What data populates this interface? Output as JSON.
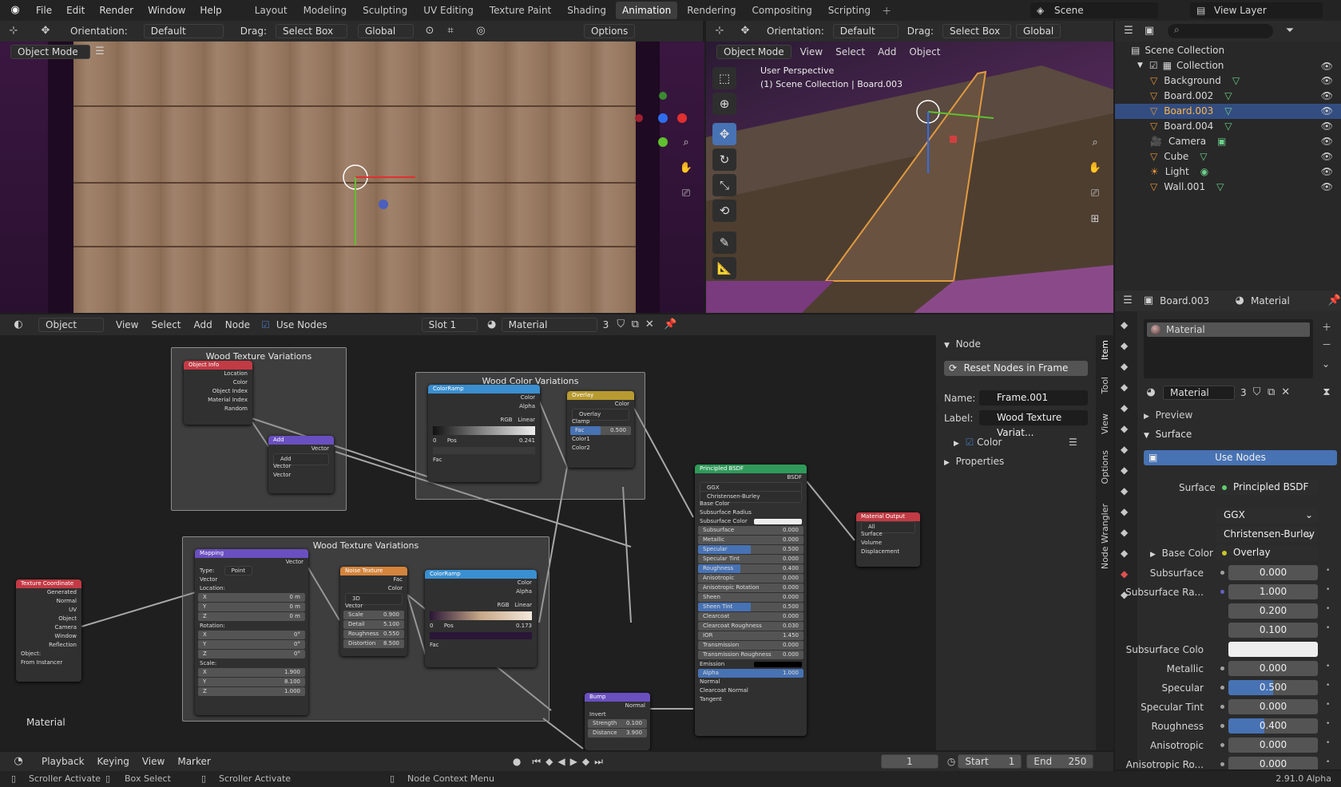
{
  "topbar": {
    "menus": [
      "File",
      "Edit",
      "Render",
      "Window",
      "Help"
    ],
    "workspaces": [
      "Layout",
      "Modeling",
      "Sculpting",
      "UV Editing",
      "Texture Paint",
      "Shading",
      "Animation",
      "Rendering",
      "Compositing",
      "Scripting"
    ],
    "active_workspace": "Animation",
    "scene": "Scene",
    "view_layer": "View Layer"
  },
  "vp_left": {
    "orientation_label": "Orientation:",
    "orientation": "Default",
    "drag_label": "Drag:",
    "drag": "Select Box",
    "transform": "Global",
    "options": "Options",
    "mode": "Object Mode"
  },
  "vp_right": {
    "orientation_label": "Orientation:",
    "orientation": "Default",
    "drag_label": "Drag:",
    "drag": "Select Box",
    "transform": "Global",
    "mode": "Object Mode",
    "menus": [
      "View",
      "Select",
      "Add",
      "Object"
    ],
    "overlay_line1": "User Perspective",
    "overlay_line2": "(1) Scene Collection | Board.003"
  },
  "outliner": {
    "root": "Scene Collection",
    "collection": "Collection",
    "items": [
      {
        "name": "Background",
        "icon": "mesh-icon"
      },
      {
        "name": "Board.002",
        "icon": "mesh-icon"
      },
      {
        "name": "Board.003",
        "icon": "mesh-icon",
        "selected": true
      },
      {
        "name": "Board.004",
        "icon": "mesh-icon"
      },
      {
        "name": "Camera",
        "icon": "camera-icon"
      },
      {
        "name": "Cube",
        "icon": "mesh-icon"
      },
      {
        "name": "Light",
        "icon": "light-icon"
      },
      {
        "name": "Wall.001",
        "icon": "mesh-icon"
      }
    ]
  },
  "node_editor": {
    "object_type": "Object",
    "menus": [
      "View",
      "Select",
      "Add",
      "Node"
    ],
    "use_nodes": "Use Nodes",
    "slot": "Slot 1",
    "material": "Material",
    "users": "3",
    "material_label": "Material",
    "frames": [
      "Wood Texture Variations",
      "Wood Color Variations",
      "Wood Texture Variations"
    ],
    "nodes": {
      "object_info": {
        "title": "Object Info",
        "outputs": [
          "Location",
          "Color",
          "Object Index",
          "Material Index",
          "Random"
        ]
      },
      "add": {
        "title": "Add",
        "out": "Vector",
        "op": "Add",
        "inputs": [
          "Vector",
          "Vector"
        ]
      },
      "colorramp1": {
        "title": "ColorRamp",
        "outputs": [
          "Color",
          "Alpha"
        ],
        "mode": "RGB",
        "interp": "Linear",
        "idx": "0",
        "pos_label": "Pos",
        "pos": "0.241",
        "fac": "Fac"
      },
      "overlay": {
        "title": "Overlay",
        "out": "Color",
        "blend": "Overlay",
        "clamp": "Clamp",
        "fac_label": "Fac",
        "fac": "0.500",
        "inputs": [
          "Color1",
          "Color2"
        ]
      },
      "texcoord": {
        "title": "Texture Coordinate",
        "outputs": [
          "Generated",
          "Normal",
          "UV",
          "Object",
          "Camera",
          "Window",
          "Reflection"
        ],
        "object_label": "Object:",
        "from_instancer": "From Instancer"
      },
      "mapping": {
        "title": "Mapping",
        "out": "Vector",
        "type_label": "Type:",
        "type": "Point",
        "vector": "Vector",
        "location": "Location:",
        "rotation": "Rotation:",
        "scale": "Scale:",
        "loc": [
          [
            "X",
            "0 m"
          ],
          [
            "Y",
            "0 m"
          ],
          [
            "Z",
            "0 m"
          ]
        ],
        "rot": [
          [
            "X",
            "0°"
          ],
          [
            "Y",
            "0°"
          ],
          [
            "Z",
            "0°"
          ]
        ],
        "scl": [
          [
            "X",
            "1.900"
          ],
          [
            "Y",
            "8.100"
          ],
          [
            "Z",
            "1.000"
          ]
        ]
      },
      "noise": {
        "title": "Noise Texture",
        "outputs": [
          "Fac",
          "Color"
        ],
        "dim": "3D",
        "vector": "Vector",
        "params": [
          [
            "Scale",
            "0.900"
          ],
          [
            "Detail",
            "5.100"
          ],
          [
            "Roughness",
            "0.550"
          ],
          [
            "Distortion",
            "8.500"
          ]
        ]
      },
      "colorramp2": {
        "title": "ColorRamp",
        "outputs": [
          "Color",
          "Alpha"
        ],
        "mode": "RGB",
        "interp": "Linear",
        "idx": "0",
        "pos_label": "Pos",
        "pos": "0.173",
        "fac": "Fac"
      },
      "bump": {
        "title": "Bump",
        "out": "Normal",
        "invert": "Invert",
        "params": [
          [
            "Strength",
            "0.100"
          ],
          [
            "Distance",
            "3.900"
          ]
        ]
      },
      "bsdf": {
        "title": "Principled BSDF",
        "out": "BSDF",
        "dist": "GGX",
        "sss": "Christensen-Burley",
        "base_color": "Base Color",
        "sss_radius": "Subsurface Radius",
        "sss_color": "Subsurface Color",
        "params": [
          [
            "Subsurface",
            "0.000"
          ],
          [
            "Metallic",
            "0.000"
          ],
          [
            "Specular",
            "0.500"
          ],
          [
            "Specular Tint",
            "0.000"
          ],
          [
            "Roughness",
            "0.400"
          ],
          [
            "Anisotropic",
            "0.000"
          ],
          [
            "Anisotropic Rotation",
            "0.000"
          ],
          [
            "Sheen",
            "0.000"
          ],
          [
            "Sheen Tint",
            "0.500"
          ],
          [
            "Clearcoat",
            "0.000"
          ],
          [
            "Clearcoat Roughness",
            "0.030"
          ],
          [
            "IOR",
            "1.450"
          ],
          [
            "Transmission",
            "0.000"
          ],
          [
            "Transmission Roughness",
            "0.000"
          ]
        ],
        "emission": "Emission",
        "alpha_label": "Alpha",
        "alpha": "1.000",
        "inputs": [
          "Normal",
          "Clearcoat Normal",
          "Tangent"
        ]
      },
      "output": {
        "title": "Material Output",
        "target": "All",
        "inputs": [
          "Surface",
          "Volume",
          "Displacement"
        ]
      }
    }
  },
  "n_panel": {
    "node": "Node",
    "reset": "Reset Nodes in Frame",
    "name_label": "Name:",
    "name": "Frame.001",
    "label_label": "Label:",
    "label": "Wood Texture Variat...",
    "color": "Color",
    "properties": "Properties",
    "tabs": [
      "Item",
      "Tool",
      "View",
      "Options",
      "Node Wrangler"
    ]
  },
  "properties": {
    "object": "Board.003",
    "material_tab": "Material",
    "slot": "Material",
    "mat_name": "Material",
    "users": "3",
    "preview": "Preview",
    "surface": "Surface",
    "use_nodes": "Use Nodes",
    "surface_label": "Surface",
    "surface_value": "Principled BSDF",
    "dist": "GGX",
    "sss": "Christensen-Burley",
    "base_color_label": "Base Color",
    "base_color_value": "Overlay",
    "rows": [
      {
        "label": "Subsurface",
        "value": "0.000",
        "fill": 0
      },
      {
        "label": "Subsurface Ra...",
        "value": "1.000",
        "fill": 0
      },
      {
        "label": "",
        "value": "0.200",
        "fill": 0
      },
      {
        "label": "",
        "value": "0.100",
        "fill": 0
      },
      {
        "label": "Subsurface Colo",
        "value": "",
        "fill": 0
      },
      {
        "label": "Metallic",
        "value": "0.000",
        "fill": 0
      },
      {
        "label": "Specular",
        "value": "0.500",
        "fill": 0.5
      },
      {
        "label": "Specular Tint",
        "value": "0.000",
        "fill": 0
      },
      {
        "label": "Roughness",
        "value": "0.400",
        "fill": 0.4
      },
      {
        "label": "Anisotropic",
        "value": "0.000",
        "fill": 0
      },
      {
        "label": "Anisotropic Ro...",
        "value": "0.000",
        "fill": 0
      }
    ]
  },
  "timeline": {
    "menus": [
      "Playback",
      "Keying",
      "View",
      "Marker"
    ],
    "frame": "1",
    "start_label": "Start",
    "start": "1",
    "end_label": "End",
    "end": "250"
  },
  "status": {
    "items": [
      "Scroller Activate",
      "Box Select",
      "Scroller Activate",
      "Node Context Menu"
    ],
    "version": "2.91.0 Alpha"
  }
}
